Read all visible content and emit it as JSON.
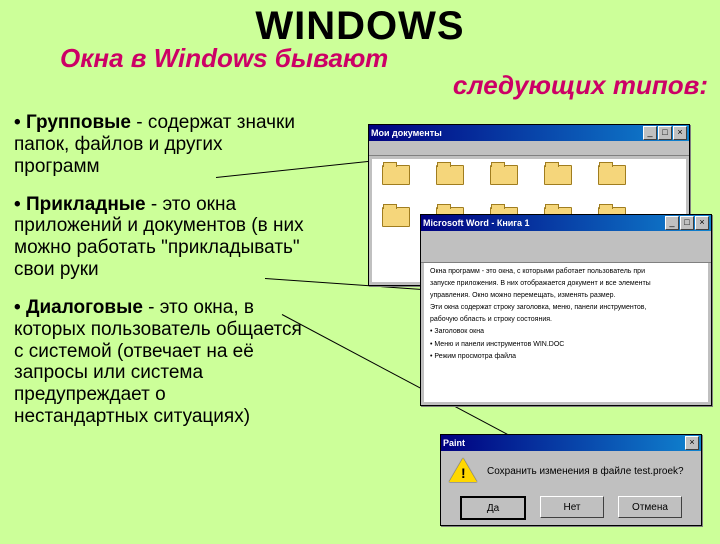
{
  "title": "WINDOWS",
  "subtitle1": "Окна в Windows бывают",
  "subtitle2": "следующих типов:",
  "items": [
    {
      "term": "Групповые",
      "desc": " - содержат значки папок, файлов и других программ"
    },
    {
      "term": "Прикладные",
      "desc": " - это окна приложений и документов (в них можно работать \"прикладывать\" свои руки"
    },
    {
      "term": "Диалоговые",
      "desc": " - это окна, в которых пользователь общается с системой (отвечает на её запросы или система предупреждает о нестандартных ситуациях)"
    }
  ],
  "folder_window": {
    "title": "Мои документы",
    "folders": [
      "",
      "",
      "",
      "",
      "",
      "",
      "",
      "",
      "",
      "",
      "",
      ""
    ]
  },
  "editor_window": {
    "title": "Microsoft Word - Книга 1",
    "lines": [
      "Окна программ - это окна, с которыми работает пользователь при",
      "запуске приложения. В них отображается документ и все элементы",
      "управления. Окно можно перемещать, изменять размер.",
      "",
      "Эти окна содержат строку заголовка, меню, панели инструментов,",
      "рабочую область и строку состояния.",
      "",
      "• Заголовок окна",
      "• Меню и панели инструментов  WIN.DOC",
      "",
      "• Режим просмотра файла"
    ]
  },
  "dialog": {
    "title": "Paint",
    "message": "Сохранить изменения в файле test.proek?",
    "buttons": [
      "Да",
      "Нет",
      "Отмена"
    ]
  }
}
